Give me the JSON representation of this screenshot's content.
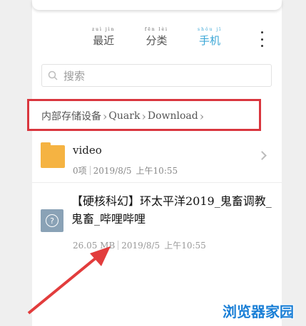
{
  "tabs": [
    {
      "label": "最近",
      "pinyin": "zuì jìn",
      "active": false
    },
    {
      "label": "分类",
      "pinyin": "fēn lèi",
      "active": false
    },
    {
      "label": "手机",
      "pinyin": "shǒu jī",
      "active": true
    }
  ],
  "search": {
    "placeholder": "搜索"
  },
  "breadcrumb": [
    "内部存储设备",
    "Quark",
    "Download"
  ],
  "folder": {
    "name": "video",
    "count": "0项",
    "date": "2019/8/5",
    "time": "上午10:55",
    "icon": "folder-icon"
  },
  "file": {
    "name": "【硬核科幻】环太平洋2019_鬼畜调教_鬼畜_哔哩哔哩",
    "size": "26.05 MB",
    "date": "2019/8/5",
    "time": "上午10:55",
    "icon": "unknown-file-icon"
  },
  "watermark": "浏览器家园",
  "colors": {
    "accent": "#3aa6d6",
    "highlight": "#d9363e",
    "folder": "#f5b342"
  }
}
